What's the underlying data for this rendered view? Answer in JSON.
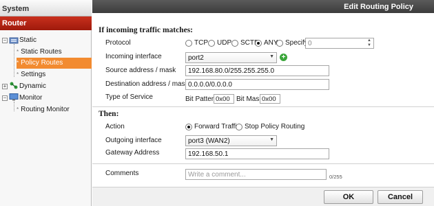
{
  "nav": {
    "section_label": "System",
    "header_label": "Router",
    "items": [
      {
        "label": "Static",
        "icon": "static-routes-folder-icon"
      },
      {
        "label": "Static Routes"
      },
      {
        "label": "Policy Routes",
        "active": true
      },
      {
        "label": "Settings"
      },
      {
        "label": "Dynamic",
        "icon": "dynamic-routing-icon"
      },
      {
        "label": "Monitor",
        "icon": "monitor-icon"
      },
      {
        "label": "Routing Monitor"
      }
    ]
  },
  "dialog": {
    "title": "Edit Routing Policy",
    "incoming_heading": "If incoming traffic matches:",
    "protocol": {
      "label": "Protocol",
      "options": [
        "TCP",
        "UDP",
        "SCTP",
        "ANY",
        "Specify"
      ],
      "selected": "ANY",
      "specify_value": "0"
    },
    "incoming_interface": {
      "label": "Incoming interface",
      "value": "port2"
    },
    "source": {
      "label": "Source address / mask",
      "value": "192.168.80.0/255.255.255.0"
    },
    "destination": {
      "label": "Destination address / mask",
      "value": "0.0.0.0/0.0.0.0"
    },
    "tos": {
      "label": "Type of Service",
      "bit_pattern_label": "Bit Pattern",
      "bit_pattern_value": "0x00",
      "bit_mask_label": "Bit Mask",
      "bit_mask_value": "0x00"
    },
    "then_heading": "Then:",
    "action": {
      "label": "Action",
      "options": [
        "Forward Traffic",
        "Stop Policy Routing"
      ],
      "selected": "Forward Traffic"
    },
    "outgoing_interface": {
      "label": "Outgoing interface",
      "value": "port3 (WAN2)"
    },
    "gateway": {
      "label": "Gateway Address",
      "value": "192.168.50.1"
    },
    "comments": {
      "label": "Comments",
      "placeholder": "Write a comment...",
      "counter": "0/255"
    },
    "ok_label": "OK",
    "cancel_label": "Cancel"
  },
  "colors": {
    "router_header": "#b52614",
    "active_item": "#f28b30",
    "title_bar": "#4a4a4a",
    "add_icon": "#3aa63a"
  }
}
